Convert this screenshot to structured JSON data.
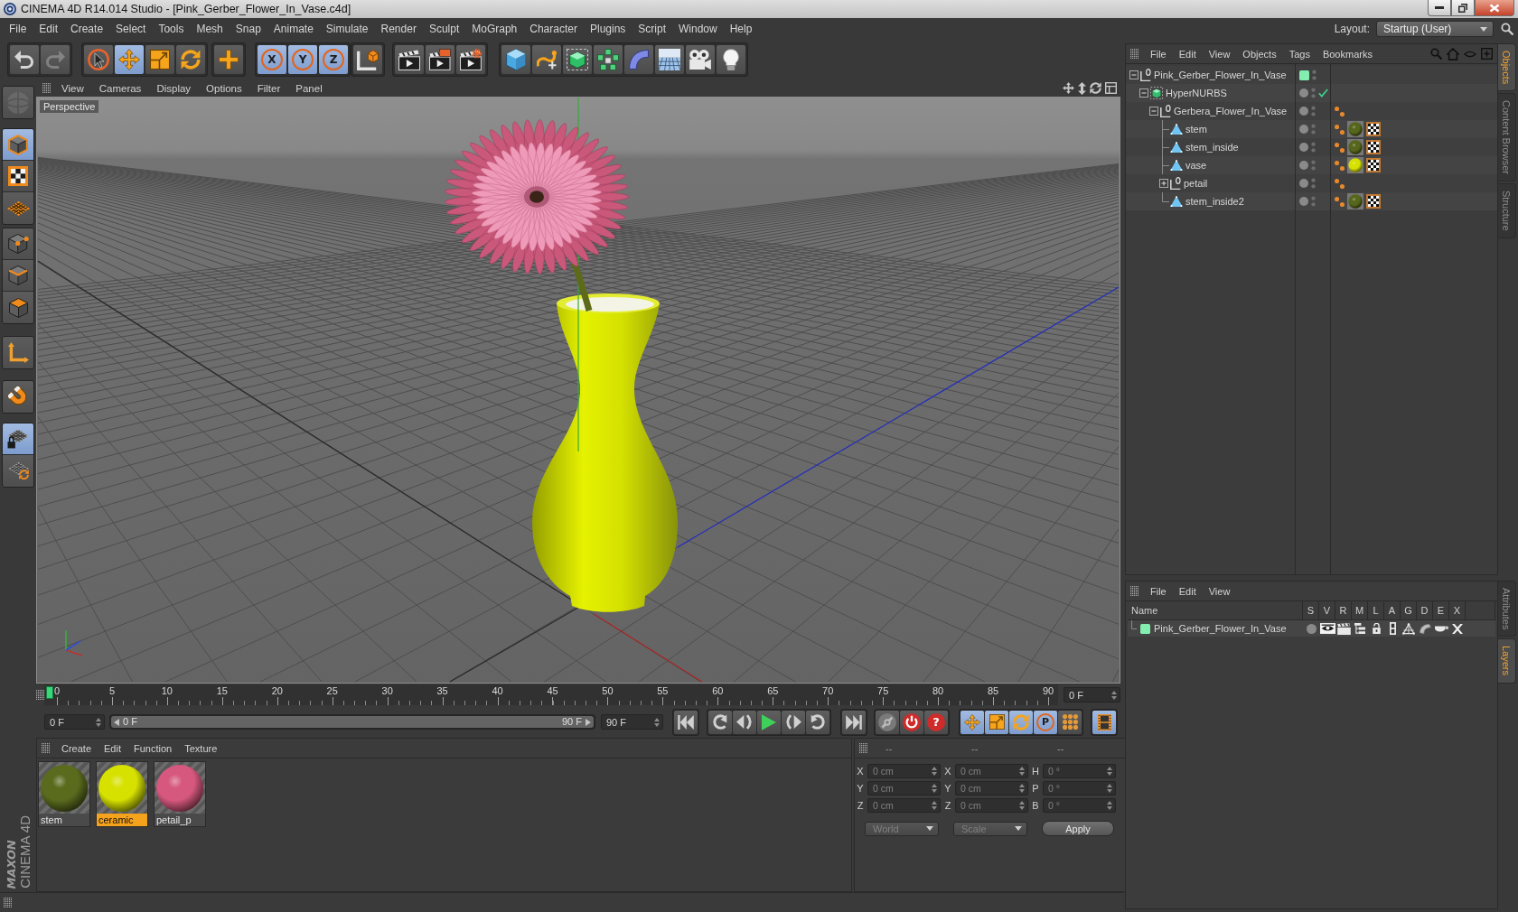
{
  "window": {
    "title": "CINEMA 4D R14.014 Studio - [Pink_Gerber_Flower_In_Vase.c4d]"
  },
  "menu_bar": {
    "items": [
      "File",
      "Edit",
      "Create",
      "Select",
      "Tools",
      "Mesh",
      "Snap",
      "Animate",
      "Simulate",
      "Render",
      "Sculpt",
      "MoGraph",
      "Character",
      "Plugins",
      "Script",
      "Window",
      "Help"
    ],
    "layout_label": "Layout:",
    "layout_value": "Startup (User)"
  },
  "toolbar": {
    "groups": [
      {
        "items": [
          {
            "kind": "undo",
            "disabled": false
          },
          {
            "kind": "redo",
            "disabled": true
          }
        ]
      },
      {
        "items": [
          {
            "kind": "select",
            "selected": false
          },
          {
            "kind": "move",
            "selected": true
          },
          {
            "kind": "scale",
            "selected": false
          },
          {
            "kind": "rotate",
            "selected": false
          }
        ]
      },
      {
        "items": [
          {
            "kind": "create",
            "selected": false
          }
        ]
      },
      {
        "items": [
          {
            "kind": "axis",
            "label": "X",
            "selected": true
          },
          {
            "kind": "axis",
            "label": "Y",
            "selected": true
          },
          {
            "kind": "axis",
            "label": "Z",
            "selected": true
          }
        ]
      },
      {
        "items": [
          {
            "kind": "world",
            "selected": false
          }
        ]
      },
      {
        "items": [
          {
            "kind": "render"
          },
          {
            "kind": "viewer"
          },
          {
            "kind": "settings"
          }
        ]
      },
      {
        "items": [
          {
            "kind": "cube"
          },
          {
            "kind": "spline"
          },
          {
            "kind": "subdivision"
          },
          {
            "kind": "cloner"
          },
          {
            "kind": "bend"
          },
          {
            "kind": "floor"
          },
          {
            "kind": "camera"
          },
          {
            "kind": "light"
          }
        ]
      }
    ]
  },
  "mode_palette": {
    "groups": [
      {
        "items": [
          {
            "kind": "editable",
            "disabled": true
          }
        ]
      },
      {
        "items": [
          {
            "kind": "model",
            "selected": true
          },
          {
            "kind": "texture",
            "selected": false
          },
          {
            "kind": "workplane",
            "selected": false
          }
        ]
      },
      {
        "items": [
          {
            "kind": "points",
            "selected": false
          },
          {
            "kind": "edges",
            "selected": false
          },
          {
            "kind": "polygons",
            "selected": false
          }
        ]
      },
      {
        "items": [
          {
            "kind": "axis",
            "selected": false
          }
        ]
      },
      {
        "items": [
          {
            "kind": "tweak",
            "selected": false
          }
        ]
      },
      {
        "items": [
          {
            "kind": "lock",
            "selected": true
          },
          {
            "kind": "snap",
            "selected": false
          }
        ]
      }
    ]
  },
  "viewport": {
    "menu": [
      "View",
      "Cameras",
      "Display",
      "Options",
      "Filter",
      "Panel"
    ],
    "camera": "Perspective"
  },
  "timeline": {
    "ruler": {
      "labels": [
        "0",
        "5",
        "10",
        "15",
        "20",
        "25",
        "30",
        "35",
        "40",
        "45",
        "50",
        "55",
        "60",
        "65",
        "70",
        "75",
        "80",
        "85",
        "90"
      ],
      "level": 0
    },
    "current_frame": "0 F",
    "start_field": "0 F",
    "range": {
      "start": "0 F",
      "end": "90 F",
      "level": 1
    },
    "end_field": "90 F",
    "key_buttons": [
      {
        "kind": "link"
      },
      {
        "kind": "record"
      },
      {
        "kind": "auto",
        "label": "?"
      }
    ],
    "mode_buttons": [
      {
        "kind": "move",
        "selected": true
      },
      {
        "kind": "scale",
        "selected": true
      },
      {
        "kind": "rotate",
        "selected": true
      },
      {
        "kind": "param",
        "label": "P",
        "selected": true
      },
      {
        "kind": "points",
        "selected": false
      }
    ],
    "timeline_button": {
      "selected": true
    }
  },
  "materials": {
    "menu": [
      "Create",
      "Edit",
      "Function",
      "Texture"
    ],
    "items": [
      {
        "name": "stem",
        "color": "#5a6b1e",
        "selected": false
      },
      {
        "name": "ceramic",
        "color": "#d7e100",
        "selected": true
      },
      {
        "name": "petail_p",
        "color": "#d6587e",
        "selected": false
      }
    ]
  },
  "coordinates": {
    "headers": [
      "--",
      "--",
      "--"
    ],
    "rows": [
      [
        {
          "label": "X",
          "value": "0 cm"
        },
        {
          "label": "X",
          "value": "0 cm"
        },
        {
          "label": "H",
          "value": "0 °"
        }
      ],
      [
        {
          "label": "Y",
          "value": "0 cm"
        },
        {
          "label": "Y",
          "value": "0 cm"
        },
        {
          "label": "P",
          "value": "0 °"
        }
      ],
      [
        {
          "label": "Z",
          "value": "0 cm"
        },
        {
          "label": "Z",
          "value": "0 cm"
        },
        {
          "label": "B",
          "value": "0 °"
        }
      ]
    ],
    "disabled": true,
    "dropdowns": [
      "World",
      "Scale"
    ],
    "apply": "Apply"
  },
  "objects": {
    "menu": [
      "File",
      "Edit",
      "View",
      "Objects",
      "Tags",
      "Bookmarks"
    ],
    "tree": [
      {
        "name": "Pink_Gerber_Flower_In_Vase",
        "kind": "null",
        "color": "#84eeb0",
        "expanded": true,
        "children": [
          {
            "name": "HyperNURBS",
            "kind": "nurbs",
            "enabled": true,
            "expanded": true,
            "children": [
              {
                "name": "Gerbera_Flower_In_Vase",
                "kind": "null",
                "expanded": true,
                "tags": [
                  {
                    "kind": "phong"
                  }
                ],
                "children": [
                  {
                    "name": "stem",
                    "kind": "polygon",
                    "tags": [
                      {
                        "kind": "phong"
                      },
                      {
                        "kind": "material",
                        "color": "#56661c"
                      },
                      {
                        "kind": "uvw"
                      }
                    ]
                  },
                  {
                    "name": "stem_inside",
                    "kind": "polygon",
                    "tags": [
                      {
                        "kind": "phong"
                      },
                      {
                        "kind": "material",
                        "color": "#56661c"
                      },
                      {
                        "kind": "uvw"
                      }
                    ]
                  },
                  {
                    "name": "vase",
                    "kind": "polygon",
                    "tags": [
                      {
                        "kind": "phong"
                      },
                      {
                        "kind": "material",
                        "color": "#d7e100"
                      },
                      {
                        "kind": "uvw"
                      }
                    ]
                  },
                  {
                    "name": "petail",
                    "kind": "null",
                    "expanded": false,
                    "tags": [
                      {
                        "kind": "phong"
                      }
                    ]
                  },
                  {
                    "name": "stem_inside2",
                    "kind": "polygon",
                    "tags": [
                      {
                        "kind": "phong"
                      },
                      {
                        "kind": "material",
                        "color": "#56661c"
                      },
                      {
                        "kind": "uvw"
                      }
                    ]
                  }
                ]
              }
            ]
          }
        ]
      }
    ]
  },
  "layers": {
    "menu": [
      "File",
      "Edit",
      "View"
    ],
    "columns": [
      "Name",
      "S",
      "V",
      "R",
      "M",
      "L",
      "A",
      "G",
      "D",
      "E",
      "X"
    ],
    "rows": [
      {
        "name": "Pink_Gerber_Flower_In_Vase",
        "color": "#84eeb0",
        "flags": [
          {
            "on": false
          },
          {
            "on": true
          },
          {
            "on": true
          },
          {
            "on": true
          },
          {
            "on": false
          },
          {
            "on": true
          },
          {
            "on": true
          },
          {
            "on": true
          },
          {
            "on": true
          },
          {
            "on": true
          }
        ]
      }
    ]
  },
  "side_tabs": {
    "upper": [
      {
        "label": "Objects",
        "selected": true
      },
      {
        "label": "Content Browser",
        "selected": false
      },
      {
        "label": "Structure",
        "selected": false
      }
    ],
    "lower": [
      {
        "label": "Attributes",
        "selected": false
      },
      {
        "label": "Layers",
        "selected": true
      }
    ]
  },
  "logo": {
    "brand": "MAXON",
    "product": "CINEMA 4D"
  }
}
